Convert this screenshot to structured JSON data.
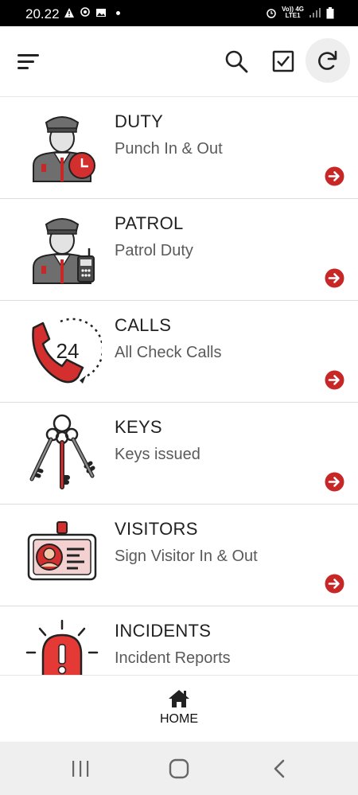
{
  "status_bar": {
    "time": "20.22",
    "network_top": "Vo)) 4G",
    "network_bottom": "LTE1"
  },
  "app_bar": {
    "icons": [
      "menu-icon",
      "search-icon",
      "checkbox-icon",
      "refresh-icon"
    ]
  },
  "menu": {
    "items": [
      {
        "title": "DUTY",
        "subtitle": "Punch In & Out",
        "icon": "guard-clock-icon"
      },
      {
        "title": "PATROL",
        "subtitle": "Patrol Duty",
        "icon": "guard-radio-icon"
      },
      {
        "title": "CALLS",
        "subtitle": "All Check Calls",
        "icon": "phone-24-icon"
      },
      {
        "title": "KEYS",
        "subtitle": "Keys issued",
        "icon": "keys-icon"
      },
      {
        "title": "VISITORS",
        "subtitle": "Sign Visitor In & Out",
        "icon": "id-badge-icon"
      },
      {
        "title": "INCIDENTS",
        "subtitle": "Incident Reports",
        "icon": "alarm-icon"
      }
    ]
  },
  "bottom_nav": {
    "home_label": "HOME"
  },
  "colors": {
    "accent_red": "#d32f2f",
    "gray_uniform": "#6e6e6e"
  }
}
